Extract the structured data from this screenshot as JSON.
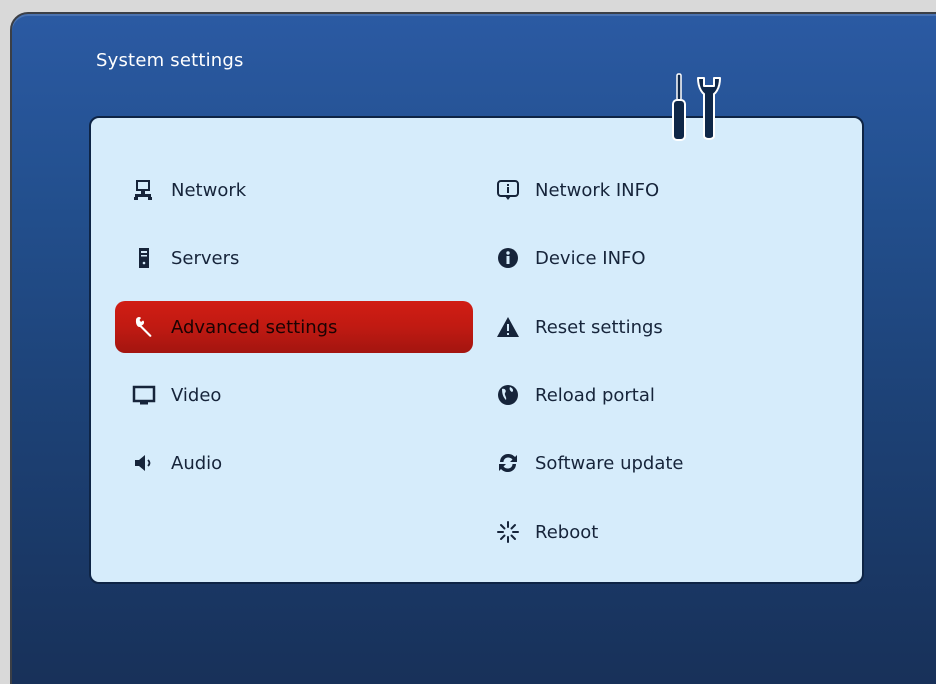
{
  "header": {
    "title": "System settings"
  },
  "menu": {
    "left": [
      {
        "label": "Network",
        "icon": "network-icon"
      },
      {
        "label": "Servers",
        "icon": "server-icon"
      },
      {
        "label": "Advanced settings",
        "icon": "wrench-icon",
        "selected": true
      },
      {
        "label": "Video",
        "icon": "monitor-icon"
      },
      {
        "label": "Audio",
        "icon": "speaker-icon"
      }
    ],
    "right": [
      {
        "label": "Network INFO",
        "icon": "info-box-icon"
      },
      {
        "label": "Device INFO",
        "icon": "info-circle-icon"
      },
      {
        "label": "Reset settings",
        "icon": "warning-icon"
      },
      {
        "label": "Reload portal",
        "icon": "globe-icon"
      },
      {
        "label": "Software update",
        "icon": "refresh-icon"
      },
      {
        "label": "Reboot",
        "icon": "spinner-icon"
      }
    ]
  },
  "colors": {
    "accent": "#c01a12",
    "panel": "#d6ecfb",
    "frame": "#23508f",
    "icon": "#16243a"
  }
}
